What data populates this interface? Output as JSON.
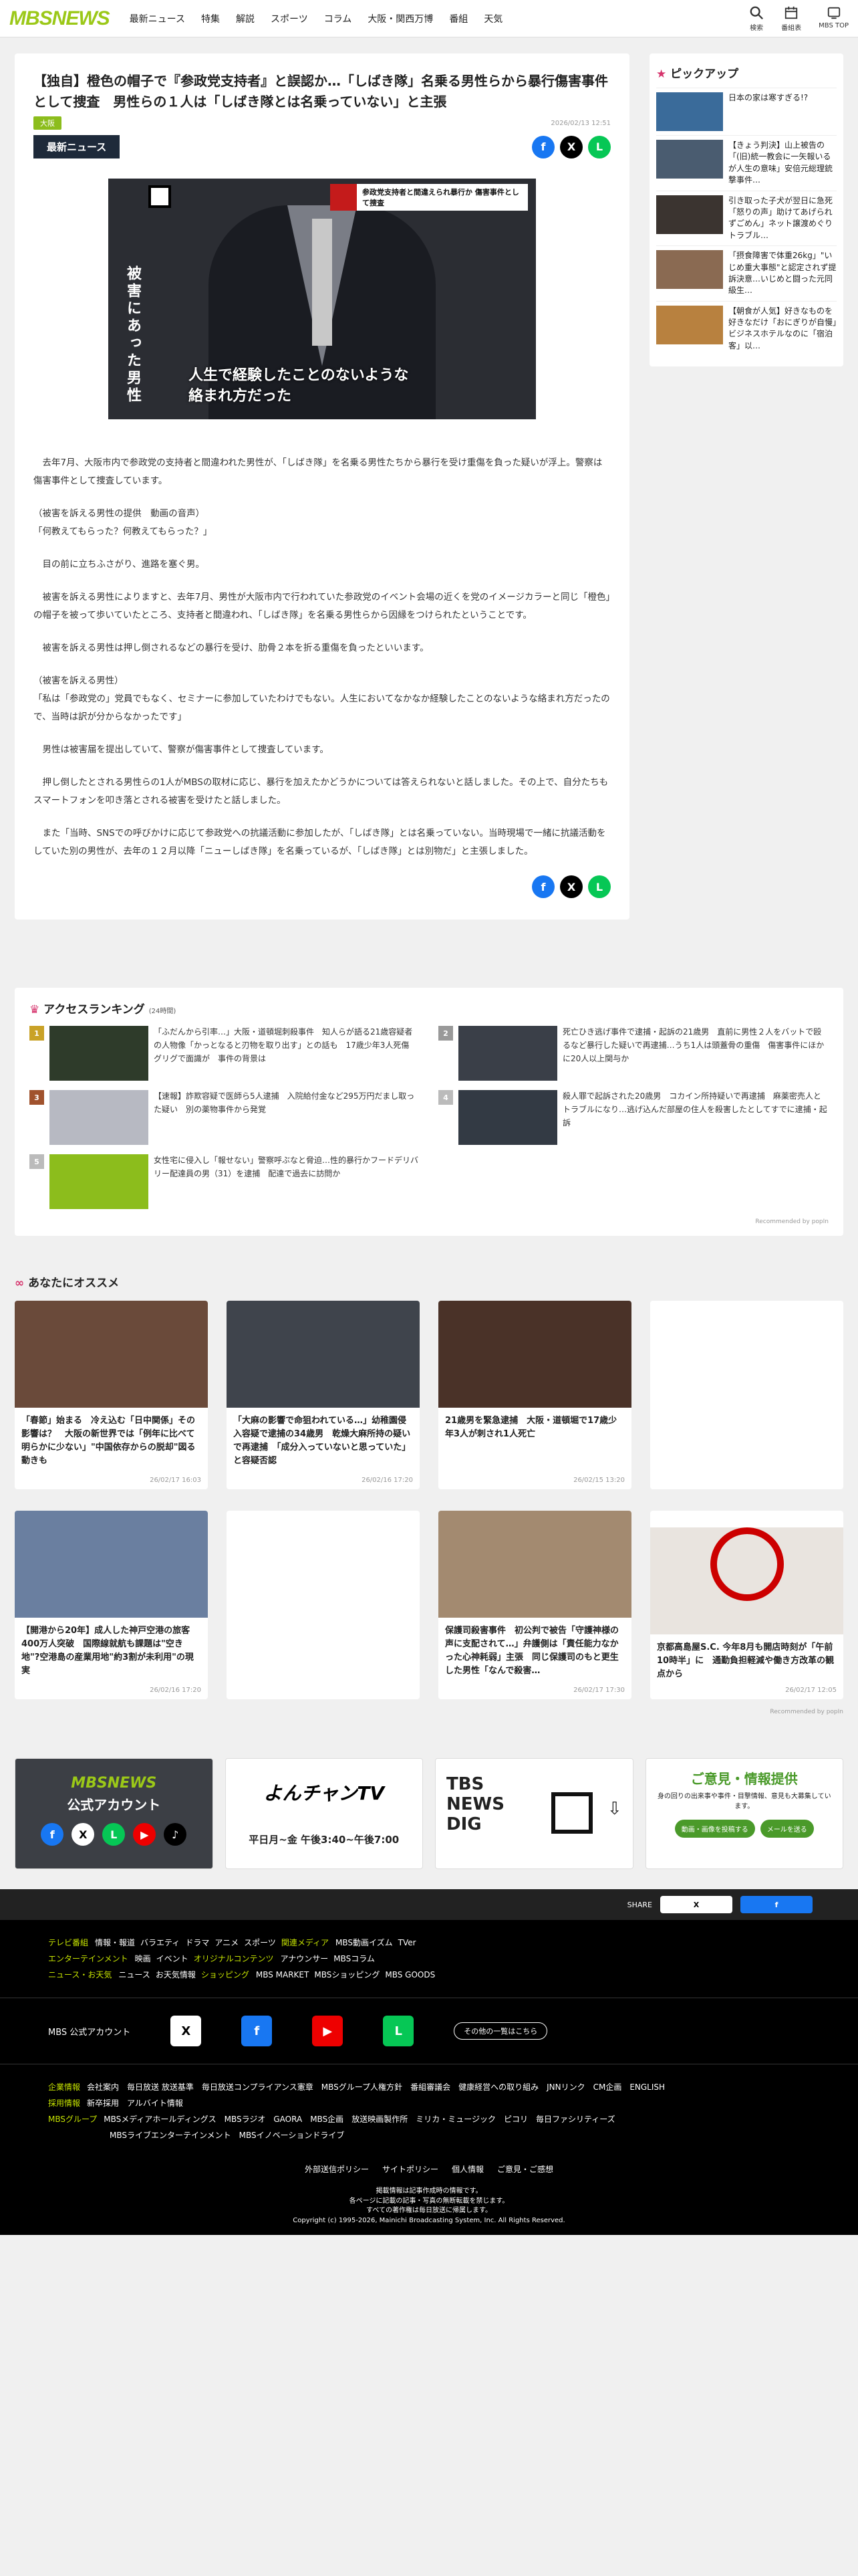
{
  "header": {
    "logo": "MBSNEWS",
    "nav": [
      "最新ニュース",
      "特集",
      "解説",
      "スポーツ",
      "コラム",
      "大阪・関西万博",
      "番組",
      "天気"
    ],
    "icons": [
      {
        "name": "search-icon",
        "label": "検索"
      },
      {
        "name": "calendar-icon",
        "label": "番組表"
      },
      {
        "name": "tv-icon",
        "label": "MBS TOP"
      }
    ]
  },
  "article": {
    "title": "【独自】橙色の帽子で『参政党支持者』と誤認か…「しばき隊」名乗る男性らから暴行傷害事件として捜査　男性らの１人は「しばき隊とは名乗っていない」と主張",
    "tag": "大阪",
    "date": "2026/02/13 12:51",
    "badge": "最新ニュース",
    "photo": {
      "vertical_label": "被害にあった男性",
      "caption_l1": "人生で経験したことのないような",
      "caption_l2": "絡まれ方だった",
      "banner": "参政党支持者と間違えられ暴行か 傷害事件として捜査"
    },
    "paragraphs": [
      "去年7月、大阪市内で参政党の支持者と間違われた男性が、「しばき隊」を名乗る男性たちから暴行を受け重傷を負った疑いが浮上。警察は傷害事件として捜査しています。",
      "（被害を訴える男性の提供　動画の音声）",
      "「何教えてもらった？何教えてもらった？」",
      "目の前に立ちふさがり、進路を塞ぐ男。",
      "被害を訴える男性によりますと、去年7月、男性が大阪市内で行われていた参政党のイベント会場の近くを党のイメージカラーと同じ「橙色」の帽子を被って歩いていたところ、支持者と間違われ、「しばき隊」を名乗る男性らから因縁をつけられたということです。",
      "被害を訴える男性は押し倒されるなどの暴行を受け、肋骨２本を折る重傷を負ったといいます。",
      "（被害を訴える男性）",
      "「私は「参政党の」党員でもなく、セミナーに参加していたわけでもない。人生においてなかなか経験したことのないような絡まれ方だったので、当時は訳が分からなかったです」",
      "男性は被害届を提出していて、警察が傷害事件として捜査しています。",
      "押し倒したとされる男性らの1人がMBSの取材に応じ、暴行を加えたかどうかについては答えられないと話しました。その上で、自分たちもスマートフォンを叩き落とされる被害を受けたと話しました。",
      "また「当時、SNSでの呼びかけに応じて参政党への抗議活動に参加したが、「しばき隊」とは名乗っていない。当時現場で一緒に抗議活動をしていた別の男性が、去年の１２月以降「ニューしばき隊」を名乗っているが、「しばき隊」とは別物だ」と主張しました。"
    ]
  },
  "sidebar": {
    "title": "ピックアップ",
    "items": [
      "日本の家は寒すぎる!?",
      "【きょう判決】山上被告の「(旧)統一教会に一矢報いるが人生の意味」安倍元総理銃撃事件…",
      "引き取った子犬が翌日に急死「怒りの声」助けてあげられずごめん」ネット譲渡めぐりトラブル…",
      "「摂食障害で体重26kg」\"いじめ重大事態\"と認定されず提訴決意…いじめと闘った元同級生…",
      "【朝食が人気】好きなものを好きなだけ「おにぎりが自慢」ビジネスホテルなのに「宿泊客」以…"
    ]
  },
  "ranking": {
    "title": "アクセスランキング",
    "period": "(24時間)",
    "items": [
      {
        "n": "1",
        "text": "「ふだんから引率…」大阪・道頓堀刺殺事件　知人らが語る21歳容疑者の人物像「かっとなると刃物を取り出す」との話も　17歳少年3人死傷　グリグで面識が　事件の背景は"
      },
      {
        "n": "2",
        "text": "死亡ひき逃げ事件で逮捕・起訴の21歳男　直前に男性２人をバットで殴るなど暴行した疑いで再逮捕…うち1人は頭蓋骨の重傷　傷害事件にほかに20人以上関与か"
      },
      {
        "n": "3",
        "text": "【速報】詐欺容疑で医師ら5人逮捕　入院給付金など295万円だまし取った疑い　別の薬物事件から発覚"
      },
      {
        "n": "4",
        "text": "殺人罪で起訴された20歳男　コカイン所持疑いで再逮捕　麻薬密売人とトラブルになり…逃げ込んだ部屋の住人を殺害したとしてすでに逮捕・起訴"
      },
      {
        "n": "5",
        "text": "女性宅に侵入し「報せない」警察呼ぶなと脅迫…性的暴行かフードデリバリー配達員の男（31）を逮捕　配達で過去に訪問か"
      }
    ],
    "recommended": "Recommended by popIn"
  },
  "osusume": {
    "title": "あなたにオススメ",
    "cards": [
      {
        "text": "「春節」始まる　冷え込む「日中関係」その影響は？　大阪の新世界では「例年に比べて明らかに少ない」\"中国依存からの脱却\"図る動きも",
        "date": "26/02/17 16:03"
      },
      {
        "text": "「大麻の影響で命狙われている…」幼稚園侵入容疑で逮捕の34歳男　乾燥大麻所持の疑いで再逮捕　「成分入っていないと思っていた」と容疑否認",
        "date": "26/02/16 17:20"
      },
      {
        "text": "21歳男を緊急逮捕　大阪・道頓堀で17歳少年3人が刺され1人死亡",
        "date": "26/02/15 13:20"
      },
      {
        "text": "",
        "date": ""
      },
      {
        "text": "【開港から20年】成人した神戸空港の旅客400万人突破　国際線就航も課題は\"空き地\"?空港島の産業用地\"約3割が未利用\"の現実",
        "date": "26/02/16 17:20"
      },
      {
        "text": "",
        "date": ""
      },
      {
        "text": "保護司殺害事件　初公判で被告「守護神様の声に支配されて…」弁護側は「責任能力なかった心神耗弱」主張　同じ保護司のもと更生した男性「なんで殺害…",
        "date": "26/02/17 17:30"
      },
      {
        "text": "京都高島屋S.C. 今年8月も開店時刻が「午前10時半」に　通勤負担軽減や働き方改革の観点から",
        "date": "26/02/17 12:05"
      }
    ]
  },
  "banners": {
    "b1_title": "MBSNEWS",
    "b1_sub": "公式アカウント",
    "b2_title": "よんチャンTV",
    "b2_time": "平日月~金 午後3:40~午後7:00",
    "b3_title": "TBS NEWS DIG",
    "b4_title": "ご意見・情報提供",
    "b4_sub": "身の回りの出来事や事件・目撃情報、意見も大募集しています。",
    "b4_btn1": "動画・画像を投稿する",
    "b4_btn2": "メールを送る"
  },
  "footer": {
    "share_label": "SHARE",
    "links1": [
      {
        "g": "テレビ番組",
        "items": [
          "情報・報道",
          "バラエティ",
          "ドラマ",
          "アニメ",
          "スポーツ"
        ]
      },
      {
        "g": "関連メディア",
        "items": [
          "MBS動画イズム",
          "TVer"
        ]
      }
    ],
    "links2": [
      {
        "g": "エンターテインメント",
        "items": [
          "映画",
          "イベント"
        ]
      },
      {
        "g": "オリジナルコンテンツ",
        "items": [
          "アナウンサー",
          "MBSコラム"
        ]
      }
    ],
    "links3": [
      {
        "g": "ニュース・お天気",
        "items": [
          "ニュース",
          "お天気情報"
        ]
      },
      {
        "g": "ショッピング",
        "items": [
          "MBS MARKET",
          "MBSショッピング",
          "MBS GOODS"
        ]
      }
    ],
    "account_label": "MBS 公式アカウント",
    "account_btn": "その他の一覧はこちら",
    "corp1": [
      "会社案内",
      "毎日放送 放送基準",
      "毎日放送コンプライアンス憲章",
      "MBSグループ人権方針",
      "番組審議会",
      "健康経営への取り組み",
      "JNNリンク",
      "CM企画",
      "ENGLISH"
    ],
    "corp2": [
      "新卒採用",
      "アルバイト情報"
    ],
    "corp3": [
      "MBSメディアホールディングス",
      "MBSラジオ",
      "GAORA",
      "MBS企画",
      "放送映画製作所",
      "ミリカ・ミュージック",
      "ピコリ",
      "毎日ファシリティーズ"
    ],
    "corp4": [
      "MBSライブエンターテインメント",
      "MBSイノベーションドライブ"
    ],
    "g_corp": "企業情報",
    "g_recruit": "採用情報",
    "g_group": "MBSグループ",
    "policy": [
      "外部送信ポリシー",
      "サイトポリシー",
      "個人情報",
      "ご意見・ご感想"
    ],
    "copy1": "掲載情報は記事作成時の情報です。",
    "copy2": "各ページに記載の記事・写真の無断転載を禁じます。",
    "copy3": "すべての著作権は毎日放送に帰属します。",
    "copy4": "Copyright (c) 1995-2026, Mainichi Broadcasting System, Inc. All Rights Reserved."
  }
}
